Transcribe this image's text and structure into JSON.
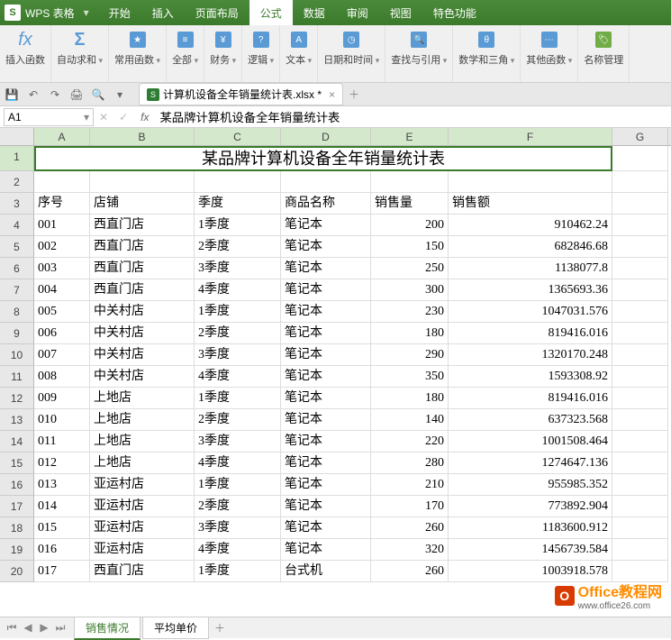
{
  "app": {
    "name": "WPS 表格"
  },
  "menu": {
    "tabs": [
      "开始",
      "插入",
      "页面布局",
      "公式",
      "数据",
      "审阅",
      "视图",
      "特色功能"
    ],
    "active": "公式"
  },
  "ribbon": {
    "insert_fn": "插入函数",
    "autosum": "自动求和",
    "common_fn": "常用函数",
    "all": "全部",
    "finance": "财务",
    "logic": "逻辑",
    "text": "文本",
    "datetime": "日期和时间",
    "lookup": "查找与引用",
    "math": "数学和三角",
    "other_fn": "其他函数",
    "name_mgr": "名称管理"
  },
  "doc_tab": {
    "filename": "计算机设备全年销量统计表.xlsx *"
  },
  "formula_bar": {
    "cell_ref": "A1",
    "fx": "fx",
    "content": "某品牌计算机设备全年销量统计表"
  },
  "columns": [
    "A",
    "B",
    "C",
    "D",
    "E",
    "F",
    "G"
  ],
  "title_row": "某品牌计算机设备全年销量统计表",
  "headers": {
    "a": "序号",
    "b": "店铺",
    "c": "季度",
    "d": "商品名称",
    "e": "销售量",
    "f": "销售额"
  },
  "chart_data": {
    "type": "table",
    "title": "某品牌计算机设备全年销量统计表",
    "columns": [
      "序号",
      "店铺",
      "季度",
      "商品名称",
      "销售量",
      "销售额"
    ],
    "rows": [
      [
        "001",
        "西直门店",
        "1季度",
        "笔记本",
        "200",
        "910462.24"
      ],
      [
        "002",
        "西直门店",
        "2季度",
        "笔记本",
        "150",
        "682846.68"
      ],
      [
        "003",
        "西直门店",
        "3季度",
        "笔记本",
        "250",
        "1138077.8"
      ],
      [
        "004",
        "西直门店",
        "4季度",
        "笔记本",
        "300",
        "1365693.36"
      ],
      [
        "005",
        "中关村店",
        "1季度",
        "笔记本",
        "230",
        "1047031.576"
      ],
      [
        "006",
        "中关村店",
        "2季度",
        "笔记本",
        "180",
        "819416.016"
      ],
      [
        "007",
        "中关村店",
        "3季度",
        "笔记本",
        "290",
        "1320170.248"
      ],
      [
        "008",
        "中关村店",
        "4季度",
        "笔记本",
        "350",
        "1593308.92"
      ],
      [
        "009",
        "上地店",
        "1季度",
        "笔记本",
        "180",
        "819416.016"
      ],
      [
        "010",
        "上地店",
        "2季度",
        "笔记本",
        "140",
        "637323.568"
      ],
      [
        "011",
        "上地店",
        "3季度",
        "笔记本",
        "220",
        "1001508.464"
      ],
      [
        "012",
        "上地店",
        "4季度",
        "笔记本",
        "280",
        "1274647.136"
      ],
      [
        "013",
        "亚运村店",
        "1季度",
        "笔记本",
        "210",
        "955985.352"
      ],
      [
        "014",
        "亚运村店",
        "2季度",
        "笔记本",
        "170",
        "773892.904"
      ],
      [
        "015",
        "亚运村店",
        "3季度",
        "笔记本",
        "260",
        "1183600.912"
      ],
      [
        "016",
        "亚运村店",
        "4季度",
        "笔记本",
        "320",
        "1456739.584"
      ],
      [
        "017",
        "西直门店",
        "1季度",
        "台式机",
        "260",
        "1003918.578"
      ]
    ]
  },
  "sheets": {
    "active": "销售情况",
    "other": "平均单价"
  },
  "watermark": {
    "brand": "Office教程网",
    "url": "www.office26.com"
  }
}
